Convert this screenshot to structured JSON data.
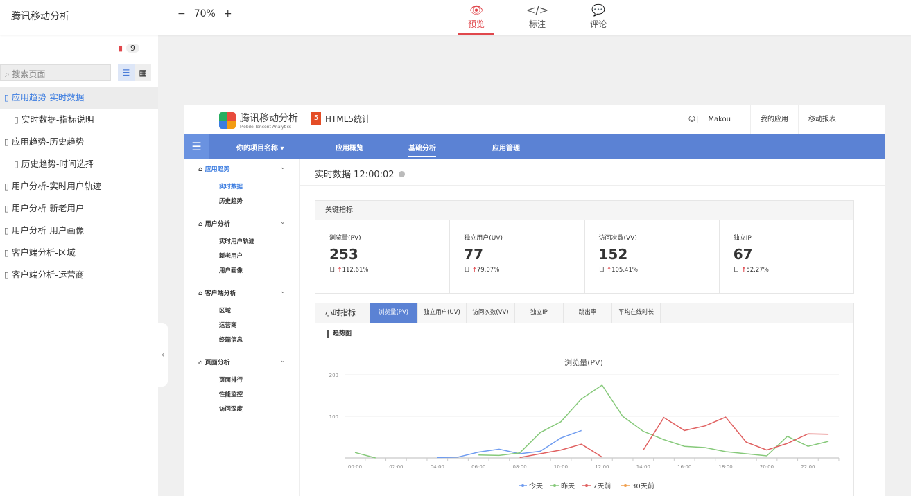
{
  "app": {
    "title": "腾讯移动分析",
    "zoom": "70%",
    "zoom_minus": "−",
    "zoom_plus": "+"
  },
  "modes": [
    {
      "label": "预览",
      "icon": "eye-icon"
    },
    {
      "label": "标注",
      "icon": "code-icon"
    },
    {
      "label": "评论",
      "icon": "comment-icon"
    }
  ],
  "pages": {
    "count": "9",
    "search_placeholder": "搜索页面",
    "items": [
      {
        "label": "应用趋势-实时数据",
        "sub": false,
        "selected": true
      },
      {
        "label": "实时数据-指标说明",
        "sub": true
      },
      {
        "label": "应用趋势-历史趋势",
        "sub": false
      },
      {
        "label": "历史趋势-时间选择",
        "sub": true
      },
      {
        "label": "用户分析-实时用户轨迹",
        "sub": false
      },
      {
        "label": "用户分析-新老用户",
        "sub": false
      },
      {
        "label": "用户分析-用户画像",
        "sub": false
      },
      {
        "label": "客户端分析-区域",
        "sub": false
      },
      {
        "label": "客户端分析-运营商",
        "sub": false
      }
    ]
  },
  "site": {
    "logo": "腾讯移动分析",
    "logo_sub": "Mobile Tencent Analytics",
    "h5": "HTML5统计",
    "h5_badge": "5",
    "user": "Makou",
    "links": [
      "我的应用",
      "移动报表"
    ],
    "nav": {
      "project": "你的项目名称 ▾",
      "items": [
        "应用概览",
        "基础分析",
        "应用管理"
      ]
    },
    "side": [
      {
        "label": "应用趋势",
        "subs": [
          "实时数据",
          "历史趋势"
        ]
      },
      {
        "label": "用户分析",
        "subs": [
          "实时用户轨迹",
          "新老用户",
          "用户画像"
        ]
      },
      {
        "label": "客户端分析",
        "subs": [
          "区域",
          "运营商",
          "终端信息"
        ]
      },
      {
        "label": "页面分析",
        "subs": [
          "页面排行",
          "性能监控",
          "访问深度"
        ]
      }
    ],
    "title": "实时数据",
    "time": "12:00:02",
    "key_title": "关键指标",
    "kpis": [
      {
        "label": "浏览量(PV)",
        "value": "253",
        "prefix": "日",
        "change": "112.61%"
      },
      {
        "label": "独立用户(UV)",
        "value": "77",
        "prefix": "日",
        "change": "79.07%"
      },
      {
        "label": "访问次数(VV)",
        "value": "152",
        "prefix": "日",
        "change": "105.41%"
      },
      {
        "label": "独立IP",
        "value": "67",
        "prefix": "日",
        "change": "52.27%"
      }
    ],
    "hour_title": "小时指标",
    "tabs": [
      "浏览量(PV)",
      "独立用户(UV)",
      "访问次数(VV)",
      "独立IP",
      "跳出率",
      "平均在线时长"
    ],
    "trend": "趋势图"
  },
  "chart_data": {
    "type": "line",
    "title": "浏览量(PV)",
    "ylim": [
      0,
      200
    ],
    "yticks": [
      "100",
      "200"
    ],
    "x": [
      "00:00",
      "01:00",
      "02:00",
      "03:00",
      "04:00",
      "05:00",
      "06:00",
      "07:00",
      "08:00",
      "09:00",
      "10:00",
      "11:00",
      "12:00",
      "13:00",
      "14:00",
      "15:00",
      "16:00",
      "17:00",
      "18:00",
      "19:00",
      "20:00",
      "21:00",
      "22:00",
      "23:00"
    ],
    "xticks": [
      "00:00",
      "02:00",
      "04:00",
      "06:00",
      "08:00",
      "10:00",
      "12:00",
      "14:00",
      "16:00",
      "18:00",
      "20:00",
      "22:00"
    ],
    "series": [
      {
        "name": "今天",
        "color": "#6f9cf0",
        "values": [
          null,
          null,
          null,
          null,
          1,
          2,
          14,
          21,
          10,
          16,
          48,
          66,
          null,
          null,
          null,
          null,
          null,
          null,
          null,
          null,
          null,
          null,
          null,
          null
        ]
      },
      {
        "name": "昨天",
        "color": "#86c97a",
        "values": [
          13,
          0,
          null,
          null,
          null,
          null,
          7,
          6,
          12,
          61,
          87,
          142,
          175,
          100,
          64,
          44,
          28,
          25,
          15,
          10,
          5,
          52,
          28,
          40
        ]
      },
      {
        "name": "7天前",
        "color": "#e06060",
        "values": [
          null,
          null,
          null,
          null,
          null,
          null,
          null,
          null,
          1,
          10,
          19,
          33,
          2,
          null,
          19,
          97,
          66,
          77,
          98,
          38,
          19,
          35,
          58,
          57
        ]
      },
      {
        "name": "30天前",
        "color": "#f0a050",
        "values": []
      }
    ]
  }
}
